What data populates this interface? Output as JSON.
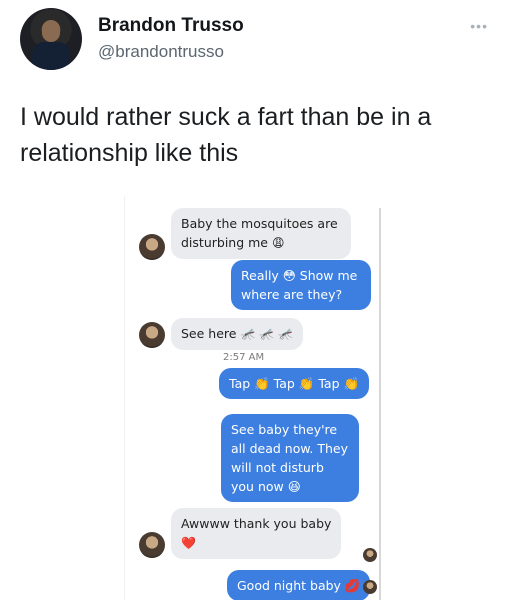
{
  "tweet": {
    "display_name": "Brandon Trusso",
    "handle": "@brandontrusso",
    "more_label": "•••",
    "text": "I would rather suck a fart than be in a relationship like this"
  },
  "chat": {
    "messages": [
      {
        "from": "them",
        "text": "Baby the mosquitoes are disturbing me",
        "emoji": "😩"
      },
      {
        "from": "me",
        "text": "Really 😳 Show me where are they?"
      },
      {
        "from": "them",
        "text": "See here",
        "emoji": "🦟 🦟 🦟"
      },
      {
        "from": "me",
        "text": "Tap 👏 Tap 👏 Tap 👏"
      },
      {
        "from": "me",
        "text": "See baby they're all dead now. They will not disturb you now 😆"
      },
      {
        "from": "them",
        "text": "Awwww thank you baby",
        "emoji": "❤️"
      },
      {
        "from": "me",
        "text": "Good night baby 💋"
      }
    ],
    "timestamp": "2:57 AM"
  }
}
